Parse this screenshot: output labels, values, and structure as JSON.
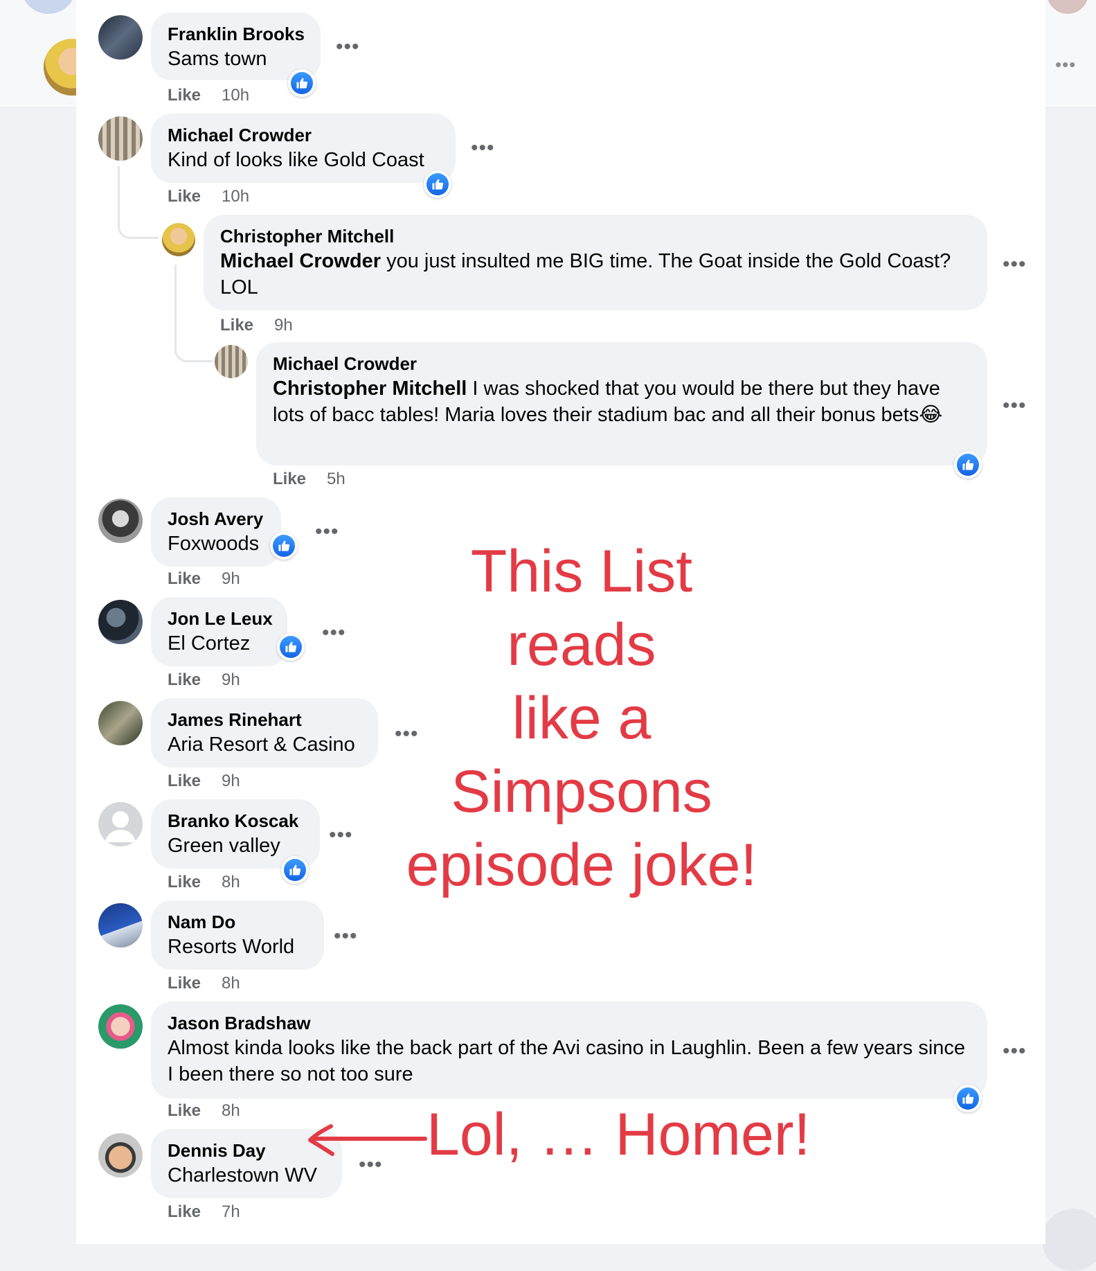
{
  "comments": [
    {
      "author": "Franklin Brooks",
      "text": "Sams town",
      "like_label": "Like",
      "time": "10h",
      "reacted": true
    },
    {
      "author": "Michael Crowder",
      "text": "Kind of looks like Gold Coast",
      "like_label": "Like",
      "time": "10h",
      "reacted": true
    },
    {
      "author": "Christopher Mitchell",
      "mention": "Michael Crowder",
      "text": " you just insulted me BIG time. The Goat inside the Gold Coast? LOL",
      "like_label": "Like",
      "time": "9h",
      "reacted": false
    },
    {
      "author": "Michael Crowder",
      "mention": "Christopher Mitchell",
      "text": " I was shocked that you would be there but they have lots of bacc tables! Maria loves their stadium bac and all their bonus bets",
      "emoji": "😂",
      "like_label": "Like",
      "time": "5h",
      "reacted": true
    },
    {
      "author": "Josh Avery",
      "text": "Foxwoods",
      "like_label": "Like",
      "time": "9h",
      "reacted": true
    },
    {
      "author": "Jon Le Leux",
      "text": "El Cortez",
      "like_label": "Like",
      "time": "9h",
      "reacted": true
    },
    {
      "author": "James Rinehart",
      "text": "Aria Resort & Casino",
      "like_label": "Like",
      "time": "9h",
      "reacted": false
    },
    {
      "author": "Branko Koscak",
      "text": "Green valley",
      "like_label": "Like",
      "time": "8h",
      "reacted": true
    },
    {
      "author": "Nam Do",
      "text": "Resorts World",
      "like_label": "Like",
      "time": "8h",
      "reacted": false
    },
    {
      "author": "Jason Bradshaw",
      "text": "Almost kinda looks like the back part of the Avi casino in Laughlin. Been a few years since I been there so not too sure",
      "like_label": "Like",
      "time": "8h",
      "reacted": true
    },
    {
      "author": "Dennis Day",
      "text": "Charlestown WV",
      "like_label": "Like",
      "time": "7h",
      "reacted": false
    }
  ],
  "more_label": "•••",
  "annotations": {
    "main_line1": "This List reads",
    "main_line2": "like a",
    "main_line3": "Simpsons",
    "main_line4": "episode joke!",
    "homer": "Lol, … Homer!"
  },
  "colors": {
    "annotation": "#e33b45",
    "reaction_blue": "#1877f2",
    "bubble": "#f0f2f5"
  },
  "icons": [
    "like-reaction-icon",
    "more-options-icon",
    "arrow-icon",
    "avatar"
  ]
}
